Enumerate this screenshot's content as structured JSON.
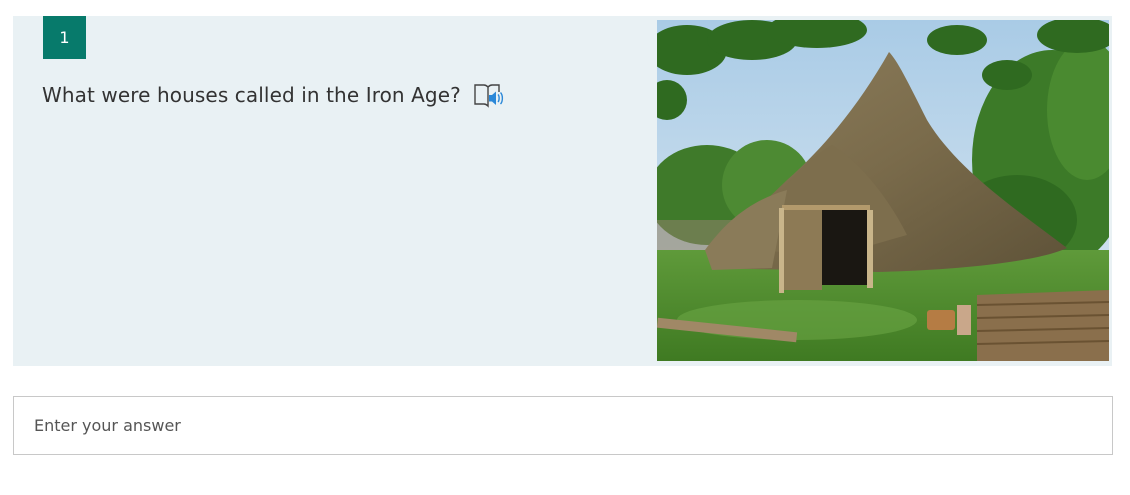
{
  "question": {
    "number": "1",
    "text": "What were houses called in the Iron Age?",
    "reader_icon": "immersive-reader-icon",
    "image_alt": "Reconstructed Iron Age roundhouse with thatched conical roof"
  },
  "answer": {
    "placeholder": "Enter your answer",
    "value": ""
  },
  "colors": {
    "number_badge": "#077a6b",
    "card_background": "#e9f1f4",
    "reader_icon_accent": "#2b88d8"
  }
}
